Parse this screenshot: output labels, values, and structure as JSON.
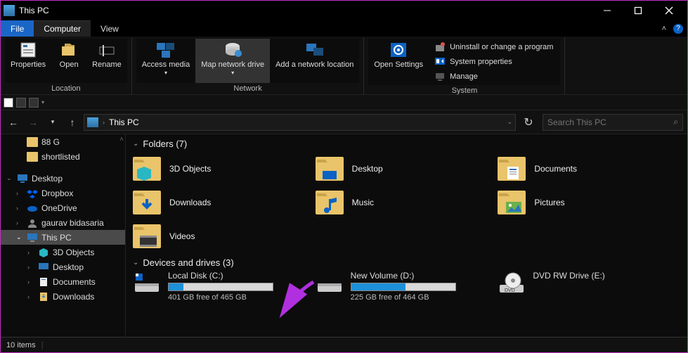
{
  "title": "This PC",
  "menus": {
    "file": "File",
    "computer": "Computer",
    "view": "View"
  },
  "ribbon": {
    "location": {
      "label": "Location",
      "properties": "Properties",
      "open": "Open",
      "rename": "Rename"
    },
    "network": {
      "label": "Network",
      "access_media": "Access media",
      "map_drive": "Map network drive",
      "add_loc": "Add a network location"
    },
    "settings": {
      "open_settings": "Open Settings"
    },
    "system": {
      "label": "System",
      "uninstall": "Uninstall or change a program",
      "sysprops": "System properties",
      "manage": "Manage"
    }
  },
  "address": {
    "text": "This PC"
  },
  "search": {
    "placeholder": "Search This PC"
  },
  "tree": {
    "quick": [
      {
        "label": "88 G"
      },
      {
        "label": "shortlisted"
      }
    ],
    "desktop": {
      "label": "Desktop"
    },
    "under": [
      {
        "label": "Dropbox",
        "icon": "dropbox"
      },
      {
        "label": "OneDrive",
        "icon": "onedrive"
      },
      {
        "label": "gaurav bidasaria",
        "icon": "user"
      }
    ],
    "thispc": {
      "label": "This PC",
      "children": [
        {
          "label": "3D Objects"
        },
        {
          "label": "Desktop"
        },
        {
          "label": "Documents"
        },
        {
          "label": "Downloads"
        }
      ]
    }
  },
  "sections": {
    "folders": {
      "title": "Folders (7)",
      "items": [
        {
          "name": "3D Objects"
        },
        {
          "name": "Desktop"
        },
        {
          "name": "Documents"
        },
        {
          "name": "Downloads"
        },
        {
          "name": "Music"
        },
        {
          "name": "Pictures"
        },
        {
          "name": "Videos"
        }
      ]
    },
    "drives": {
      "title": "Devices and drives (3)",
      "items": [
        {
          "name": "Local Disk (C:)",
          "free": "401 GB free of 465 GB",
          "fill": 14
        },
        {
          "name": "New Volume (D:)",
          "free": "225 GB free of 464 GB",
          "fill": 52
        },
        {
          "name": "DVD RW Drive (E:)",
          "type": "dvd"
        }
      ]
    }
  },
  "status": {
    "text": "10 items"
  }
}
